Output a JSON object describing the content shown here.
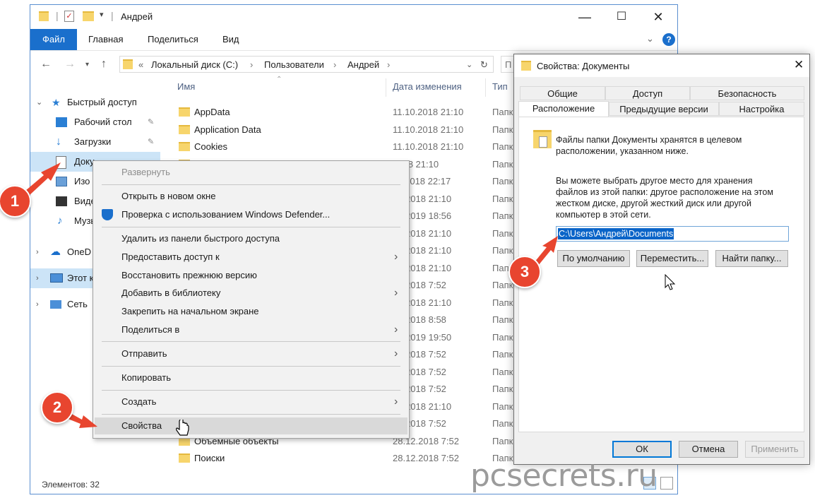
{
  "explorer": {
    "title": "Андрей",
    "ribbon_tabs": [
      "Файл",
      "Главная",
      "Поделиться",
      "Вид"
    ],
    "address": {
      "prefix": "«",
      "crumbs": [
        "Локальный диск (C:)",
        "Пользователи",
        "Андрей"
      ]
    },
    "search_placeholder": "П",
    "nav": {
      "quick_access": "Быстрый доступ",
      "desktop": "Рабочий стол",
      "downloads": "Загрузки",
      "documents": "Доку",
      "images": "Изо",
      "video": "Виде",
      "music": "Музы",
      "onedrive": "OneD",
      "this_pc": "Этот к",
      "network": "Сеть"
    },
    "columns": {
      "name": "Имя",
      "date": "Дата изменения",
      "type": "Тип"
    },
    "rows": [
      {
        "name": "AppData",
        "date": "11.10.2018 21:10",
        "type": "Папк"
      },
      {
        "name": "Application Data",
        "date": "11.10.2018 21:10",
        "type": "Папк"
      },
      {
        "name": "Cookies",
        "date": "11.10.2018 21:10",
        "type": "Папк"
      },
      {
        "name": "",
        "date": "2018 21:10",
        "type": "Папк"
      },
      {
        "name": "",
        "date": "11.2018 22:17",
        "type": "Папк"
      },
      {
        "name": "",
        "date": "10.2018 21:10",
        "type": "Папк"
      },
      {
        "name": "",
        "date": "02.2019 18:56",
        "type": "Папк"
      },
      {
        "name": "",
        "date": "10.2018 21:10",
        "type": "Папк"
      },
      {
        "name": "",
        "date": "10.2018 21:10",
        "type": "Папк"
      },
      {
        "name": "",
        "date": "10.2018 21:10",
        "type": "Папк"
      },
      {
        "name": "",
        "date": "12.2018 7:52",
        "type": "Папк"
      },
      {
        "name": "",
        "date": "10.2018 21:10",
        "type": "Папк"
      },
      {
        "name": "",
        "date": "12.2018 8:58",
        "type": "Папк"
      },
      {
        "name": "",
        "date": "02.2019 19:50",
        "type": "Папк"
      },
      {
        "name": "",
        "date": "12.2018 7:52",
        "type": "Папк"
      },
      {
        "name": "",
        "date": "12.2018 7:52",
        "type": "Папк"
      },
      {
        "name": "",
        "date": "12.2018 7:52",
        "type": "Папк"
      },
      {
        "name": "",
        "date": "10.2018 21:10",
        "type": "Папк"
      },
      {
        "name": "",
        "date": "12.2018 7:52",
        "type": "Папк"
      },
      {
        "name": "Объемные объекты",
        "date": "28.12.2018 7:52",
        "type": "Папк"
      },
      {
        "name": "Поиски",
        "date": "28.12.2018 7:52",
        "type": "Папк"
      }
    ],
    "status": "Элементов: 32"
  },
  "context_menu": {
    "items": [
      {
        "label": "Развернуть",
        "disabled": true
      },
      {
        "label": "Открыть в новом окне"
      },
      {
        "label": "Проверка с использованием Windows Defender..."
      },
      {
        "label": "Удалить из панели быстрого доступа"
      },
      {
        "label": "Предоставить доступ к"
      },
      {
        "label": "Восстановить прежнюю версию"
      },
      {
        "label": "Добавить в библиотеку"
      },
      {
        "label": "Закрепить на начальном экране"
      },
      {
        "label": "Поделиться в"
      },
      {
        "label": "Отправить"
      },
      {
        "label": "Копировать"
      },
      {
        "label": "Создать"
      },
      {
        "label": "Свойства"
      }
    ]
  },
  "dialog": {
    "title": "Свойства: Документы",
    "tabs_row1": [
      "Общие",
      "Доступ",
      "Безопасность"
    ],
    "tabs_row2": [
      "Расположение",
      "Предыдущие версии",
      "Настройка"
    ],
    "info": "Файлы папки Документы хранятся в целевом расположении, указанном ниже.",
    "info_line1": "Файлы папки Документы хранятся в целевом",
    "info_line2": "расположении, указанном ниже.",
    "desc_line1": "Вы можете выбрать другое место для хранения",
    "desc_line2": "файлов из этой папки: другое расположение на этом",
    "desc_line3": "жестком диске, другой жесткий диск или другой",
    "desc_line4": "компьютер в этой сети.",
    "path": "C:\\Users\\Андрей\\Documents",
    "btn_default": "По умолчанию",
    "btn_move": "Переместить...",
    "btn_find": "Найти папку...",
    "btn_ok": "ОК",
    "btn_cancel": "Отмена",
    "btn_apply": "Применить"
  },
  "callouts": [
    "1",
    "2",
    "3"
  ],
  "watermark": "pcsecrets.ru",
  "colors": {
    "accent": "#1a6fcc",
    "callout": "#e8452f",
    "selection": "#cce4f7"
  }
}
